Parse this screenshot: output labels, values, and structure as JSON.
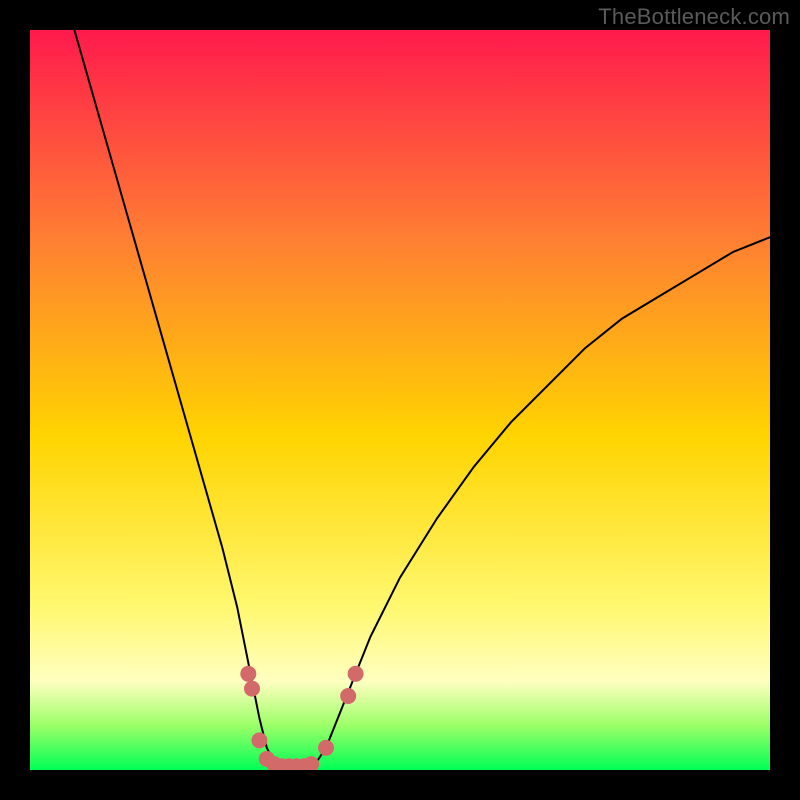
{
  "watermark": "TheBottleneck.com",
  "colors": {
    "frame_bg": "#000000",
    "grad_top": "#ff1a4c",
    "grad_mid_upper": "#ff7e33",
    "grad_mid": "#ffd400",
    "grad_lower": "#fff870",
    "grad_pale": "#ffffc0",
    "grad_green_light": "#9CFF68",
    "grad_green": "#00ff55",
    "curve_stroke": "#000000",
    "marker_fill": "#d36a6a"
  },
  "chart_data": {
    "type": "line",
    "title": "",
    "xlabel": "",
    "ylabel": "",
    "xlim": [
      0,
      100
    ],
    "ylim": [
      0,
      100
    ],
    "x": [
      6,
      8,
      10,
      12,
      14,
      16,
      18,
      20,
      22,
      24,
      26,
      28,
      29,
      30,
      31,
      32,
      33,
      34,
      35,
      36,
      37,
      38,
      40,
      42,
      44,
      46,
      48,
      50,
      55,
      60,
      65,
      70,
      75,
      80,
      85,
      90,
      95,
      100
    ],
    "y": [
      100,
      93,
      86,
      79,
      72,
      65,
      58,
      51,
      44,
      37,
      30,
      22,
      17,
      12,
      7,
      3,
      1,
      0,
      0,
      0,
      0,
      0,
      3,
      8,
      13,
      18,
      22,
      26,
      34,
      41,
      47,
      52,
      57,
      61,
      64,
      67,
      70,
      72
    ],
    "vertex_x": 35,
    "markers": [
      {
        "x": 29.5,
        "y": 13
      },
      {
        "x": 30,
        "y": 11
      },
      {
        "x": 31,
        "y": 4
      },
      {
        "x": 32,
        "y": 1.5
      },
      {
        "x": 33,
        "y": 0.8
      },
      {
        "x": 34,
        "y": 0.5
      },
      {
        "x": 35,
        "y": 0.5
      },
      {
        "x": 36,
        "y": 0.5
      },
      {
        "x": 37,
        "y": 0.5
      },
      {
        "x": 38,
        "y": 0.8
      },
      {
        "x": 40,
        "y": 3
      },
      {
        "x": 43,
        "y": 10
      },
      {
        "x": 44,
        "y": 13
      }
    ],
    "marker_radius_px": 8,
    "annotations": []
  }
}
